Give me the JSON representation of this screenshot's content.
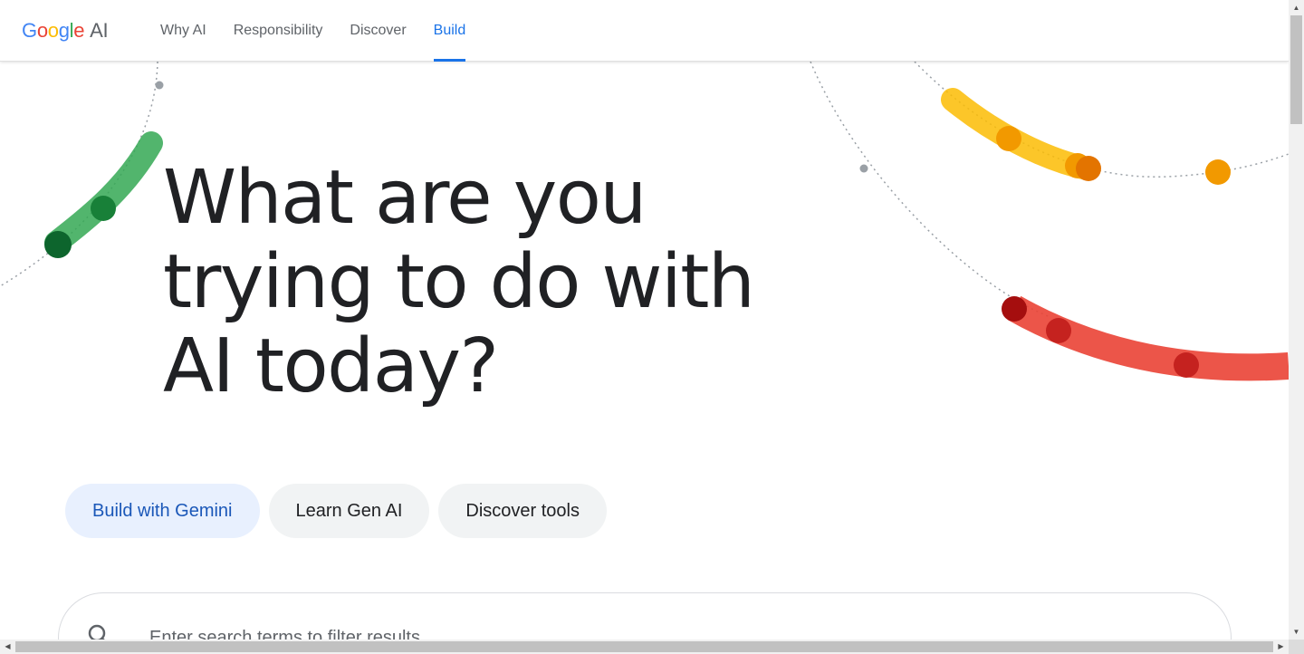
{
  "header": {
    "logo": {
      "google": "Google",
      "ai": "AI"
    },
    "nav": [
      {
        "label": "Why AI",
        "active": false
      },
      {
        "label": "Responsibility",
        "active": false
      },
      {
        "label": "Discover",
        "active": false
      },
      {
        "label": "Build",
        "active": true
      }
    ]
  },
  "hero": {
    "title_lines": [
      "What are you",
      "trying to do with",
      "AI today?"
    ]
  },
  "chips": [
    {
      "label": "Build with Gemini",
      "selected": true
    },
    {
      "label": "Learn Gen AI",
      "selected": false
    },
    {
      "label": "Discover tools",
      "selected": false
    }
  ],
  "search": {
    "placeholder": "Enter search terms to filter results",
    "value": ""
  },
  "colors": {
    "accent": "#1a73e8",
    "green": "#34a853",
    "yellow": "#fbbc04",
    "red": "#ea4335"
  }
}
